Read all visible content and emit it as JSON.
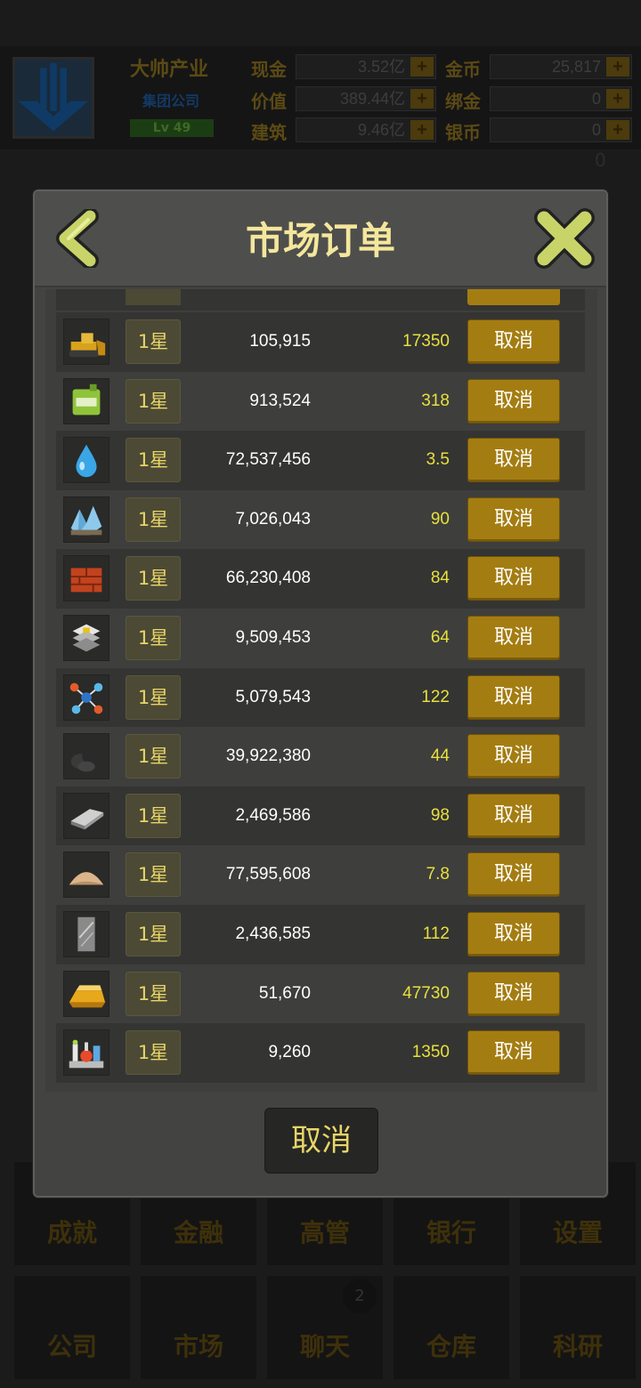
{
  "background": {
    "company_name": "大帅产业",
    "company_type": "集团公司",
    "level": "Lv 49",
    "stats": [
      {
        "label": "现金",
        "value": "3.52亿"
      },
      {
        "label": "价值",
        "value": "389.44亿"
      },
      {
        "label": "建筑",
        "value": "9.46亿"
      },
      {
        "label": "金币",
        "value": "25,817"
      },
      {
        "label": "绑金",
        "value": "0"
      },
      {
        "label": "银币",
        "value": "0"
      }
    ],
    "plus_label": "+",
    "nav_top": [
      "成就",
      "金融",
      "高管",
      "银行",
      "设置"
    ],
    "nav_bottom": [
      "公司",
      "市场",
      "聊天",
      "仓库",
      "科研"
    ],
    "chat_badge": "2",
    "top_counter": "0"
  },
  "dialog": {
    "title": "市场订单",
    "footer_cancel": "取消",
    "rows": [
      {
        "icon": "bulldozer-icon",
        "star": "1星",
        "qty": "105,915",
        "price": "17350",
        "action": "取消"
      },
      {
        "icon": "green-canister-icon",
        "star": "1星",
        "qty": "913,524",
        "price": "318",
        "action": "取消"
      },
      {
        "icon": "water-drop-icon",
        "star": "1星",
        "qty": "72,537,456",
        "price": "3.5",
        "action": "取消"
      },
      {
        "icon": "crystal-ore-icon",
        "star": "1星",
        "qty": "7,026,043",
        "price": "90",
        "action": "取消"
      },
      {
        "icon": "red-bricks-icon",
        "star": "1星",
        "qty": "66,230,408",
        "price": "84",
        "action": "取消"
      },
      {
        "icon": "steel-plates-icon",
        "star": "1星",
        "qty": "9,509,453",
        "price": "64",
        "action": "取消"
      },
      {
        "icon": "molecule-icon",
        "star": "1星",
        "qty": "5,079,543",
        "price": "122",
        "action": "取消"
      },
      {
        "icon": "coal-icon",
        "star": "1星",
        "qty": "39,922,380",
        "price": "44",
        "action": "取消"
      },
      {
        "icon": "iron-ingot-icon",
        "star": "1星",
        "qty": "2,469,586",
        "price": "98",
        "action": "取消"
      },
      {
        "icon": "sand-pile-icon",
        "star": "1星",
        "qty": "77,595,608",
        "price": "7.8",
        "action": "取消"
      },
      {
        "icon": "glass-panel-icon",
        "star": "1星",
        "qty": "2,436,585",
        "price": "112",
        "action": "取消"
      },
      {
        "icon": "gold-bar-icon",
        "star": "1星",
        "qty": "51,670",
        "price": "47730",
        "action": "取消"
      },
      {
        "icon": "chemical-lab-icon",
        "star": "1星",
        "qty": "9,260",
        "price": "1350",
        "action": "取消"
      }
    ]
  }
}
